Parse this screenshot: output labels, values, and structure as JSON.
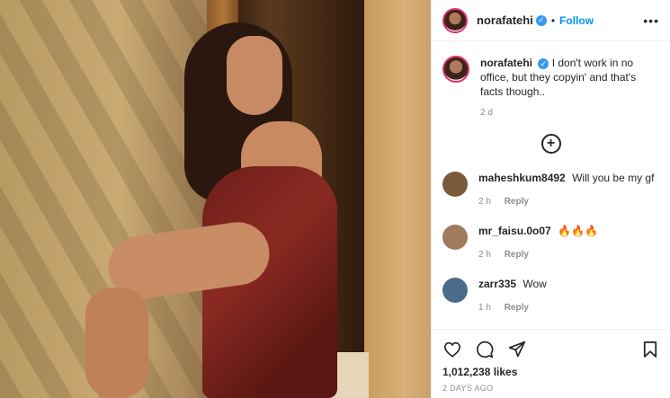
{
  "post": {
    "username": "norafatehi",
    "verified_badge": "✓",
    "follow_label": "Follow",
    "more_label": "•••",
    "caption": {
      "username": "norafatehi",
      "text": "I don't work in no office, but they copyin' and that's facts though..",
      "time": "2 d"
    },
    "load_more_label": "+"
  },
  "comments": [
    {
      "username": "maheshkum8492",
      "text": "Will you be my gf",
      "time": "2 h",
      "reply": "Reply",
      "avatar_color": "#7a5a3a"
    },
    {
      "username": "mr_faisu.0o07",
      "text": "🔥🔥🔥",
      "time": "2 h",
      "reply": "Reply",
      "avatar_color": "#a07a5e"
    },
    {
      "username": "zarr335",
      "text": "Wow",
      "time": "1 h",
      "reply": "Reply",
      "avatar_color": "#4a6b8a"
    }
  ],
  "actions": {
    "likes": "1,012,238 likes",
    "posted": "2 DAYS AGO"
  },
  "icons": [
    "heart-icon",
    "comment-icon",
    "share-icon",
    "bookmark-icon",
    "plus-circle-icon",
    "more-icon",
    "verified-icon"
  ],
  "colors": {
    "accent": "#0095f6",
    "verified": "#3897f0",
    "muted": "#8e8e8e",
    "text": "#262626"
  }
}
